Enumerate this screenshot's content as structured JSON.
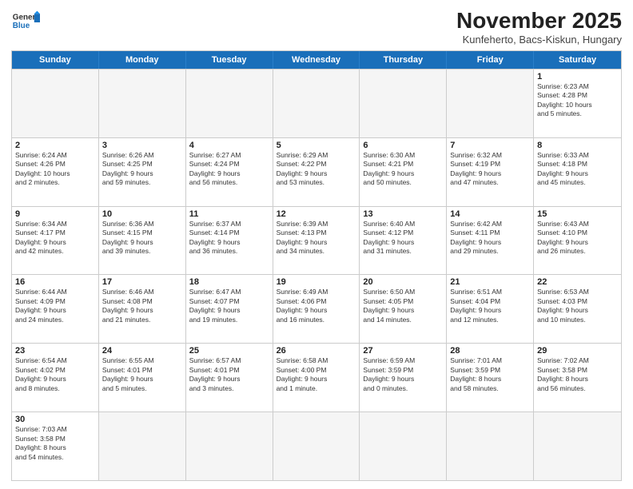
{
  "header": {
    "logo_general": "General",
    "logo_blue": "Blue",
    "month_title": "November 2025",
    "subtitle": "Kunfeherto, Bacs-Kiskun, Hungary"
  },
  "days_of_week": [
    "Sunday",
    "Monday",
    "Tuesday",
    "Wednesday",
    "Thursday",
    "Friday",
    "Saturday"
  ],
  "weeks": [
    [
      {
        "day": "",
        "empty": true
      },
      {
        "day": "",
        "empty": true
      },
      {
        "day": "",
        "empty": true
      },
      {
        "day": "",
        "empty": true
      },
      {
        "day": "",
        "empty": true
      },
      {
        "day": "",
        "empty": true
      },
      {
        "day": "1",
        "info": "Sunrise: 6:23 AM\nSunset: 4:28 PM\nDaylight: 10 hours\nand 5 minutes."
      }
    ],
    [
      {
        "day": "2",
        "info": "Sunrise: 6:24 AM\nSunset: 4:26 PM\nDaylight: 10 hours\nand 2 minutes."
      },
      {
        "day": "3",
        "info": "Sunrise: 6:26 AM\nSunset: 4:25 PM\nDaylight: 9 hours\nand 59 minutes."
      },
      {
        "day": "4",
        "info": "Sunrise: 6:27 AM\nSunset: 4:24 PM\nDaylight: 9 hours\nand 56 minutes."
      },
      {
        "day": "5",
        "info": "Sunrise: 6:29 AM\nSunset: 4:22 PM\nDaylight: 9 hours\nand 53 minutes."
      },
      {
        "day": "6",
        "info": "Sunrise: 6:30 AM\nSunset: 4:21 PM\nDaylight: 9 hours\nand 50 minutes."
      },
      {
        "day": "7",
        "info": "Sunrise: 6:32 AM\nSunset: 4:19 PM\nDaylight: 9 hours\nand 47 minutes."
      },
      {
        "day": "8",
        "info": "Sunrise: 6:33 AM\nSunset: 4:18 PM\nDaylight: 9 hours\nand 45 minutes."
      }
    ],
    [
      {
        "day": "9",
        "info": "Sunrise: 6:34 AM\nSunset: 4:17 PM\nDaylight: 9 hours\nand 42 minutes."
      },
      {
        "day": "10",
        "info": "Sunrise: 6:36 AM\nSunset: 4:15 PM\nDaylight: 9 hours\nand 39 minutes."
      },
      {
        "day": "11",
        "info": "Sunrise: 6:37 AM\nSunset: 4:14 PM\nDaylight: 9 hours\nand 36 minutes."
      },
      {
        "day": "12",
        "info": "Sunrise: 6:39 AM\nSunset: 4:13 PM\nDaylight: 9 hours\nand 34 minutes."
      },
      {
        "day": "13",
        "info": "Sunrise: 6:40 AM\nSunset: 4:12 PM\nDaylight: 9 hours\nand 31 minutes."
      },
      {
        "day": "14",
        "info": "Sunrise: 6:42 AM\nSunset: 4:11 PM\nDaylight: 9 hours\nand 29 minutes."
      },
      {
        "day": "15",
        "info": "Sunrise: 6:43 AM\nSunset: 4:10 PM\nDaylight: 9 hours\nand 26 minutes."
      }
    ],
    [
      {
        "day": "16",
        "info": "Sunrise: 6:44 AM\nSunset: 4:09 PM\nDaylight: 9 hours\nand 24 minutes."
      },
      {
        "day": "17",
        "info": "Sunrise: 6:46 AM\nSunset: 4:08 PM\nDaylight: 9 hours\nand 21 minutes."
      },
      {
        "day": "18",
        "info": "Sunrise: 6:47 AM\nSunset: 4:07 PM\nDaylight: 9 hours\nand 19 minutes."
      },
      {
        "day": "19",
        "info": "Sunrise: 6:49 AM\nSunset: 4:06 PM\nDaylight: 9 hours\nand 16 minutes."
      },
      {
        "day": "20",
        "info": "Sunrise: 6:50 AM\nSunset: 4:05 PM\nDaylight: 9 hours\nand 14 minutes."
      },
      {
        "day": "21",
        "info": "Sunrise: 6:51 AM\nSunset: 4:04 PM\nDaylight: 9 hours\nand 12 minutes."
      },
      {
        "day": "22",
        "info": "Sunrise: 6:53 AM\nSunset: 4:03 PM\nDaylight: 9 hours\nand 10 minutes."
      }
    ],
    [
      {
        "day": "23",
        "info": "Sunrise: 6:54 AM\nSunset: 4:02 PM\nDaylight: 9 hours\nand 8 minutes."
      },
      {
        "day": "24",
        "info": "Sunrise: 6:55 AM\nSunset: 4:01 PM\nDaylight: 9 hours\nand 5 minutes."
      },
      {
        "day": "25",
        "info": "Sunrise: 6:57 AM\nSunset: 4:01 PM\nDaylight: 9 hours\nand 3 minutes."
      },
      {
        "day": "26",
        "info": "Sunrise: 6:58 AM\nSunset: 4:00 PM\nDaylight: 9 hours\nand 1 minute."
      },
      {
        "day": "27",
        "info": "Sunrise: 6:59 AM\nSunset: 3:59 PM\nDaylight: 9 hours\nand 0 minutes."
      },
      {
        "day": "28",
        "info": "Sunrise: 7:01 AM\nSunset: 3:59 PM\nDaylight: 8 hours\nand 58 minutes."
      },
      {
        "day": "29",
        "info": "Sunrise: 7:02 AM\nSunset: 3:58 PM\nDaylight: 8 hours\nand 56 minutes."
      }
    ],
    [
      {
        "day": "30",
        "info": "Sunrise: 7:03 AM\nSunset: 3:58 PM\nDaylight: 8 hours\nand 54 minutes."
      },
      {
        "day": "",
        "empty": true
      },
      {
        "day": "",
        "empty": true
      },
      {
        "day": "",
        "empty": true
      },
      {
        "day": "",
        "empty": true
      },
      {
        "day": "",
        "empty": true
      },
      {
        "day": "",
        "empty": true
      }
    ]
  ]
}
